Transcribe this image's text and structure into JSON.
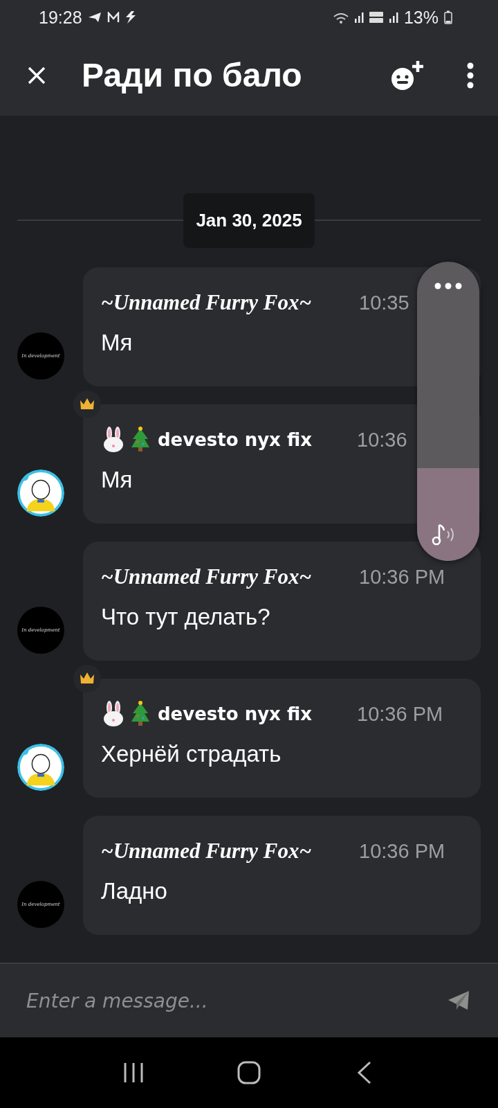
{
  "status_bar": {
    "time": "19:28",
    "battery": "13%"
  },
  "header": {
    "title": "Ради по бало"
  },
  "date_divider": "Jan 30, 2025",
  "messages": [
    {
      "kind": "plain",
      "author": "~Unnamed Furry Fox~",
      "time": "10:35",
      "text": "Мя",
      "avatar_text": "In development"
    },
    {
      "kind": "owner",
      "author": "devesto nyx fix",
      "time": "10:36",
      "text": "Мя"
    },
    {
      "kind": "plain",
      "author": "~Unnamed Furry Fox~",
      "time": "10:36 PM",
      "text": "Что тут делать?",
      "avatar_text": "In development"
    },
    {
      "kind": "owner",
      "author": "devesto nyx fix",
      "time": "10:36 PM",
      "text": "Хернёй страдать"
    },
    {
      "kind": "plain",
      "author": "~Unnamed Furry Fox~",
      "time": "10:36 PM",
      "text": "Ладно",
      "avatar_text": "In development"
    }
  ],
  "composer": {
    "placeholder": "Enter a message..."
  },
  "volume_panel": {
    "level": 0.31
  }
}
